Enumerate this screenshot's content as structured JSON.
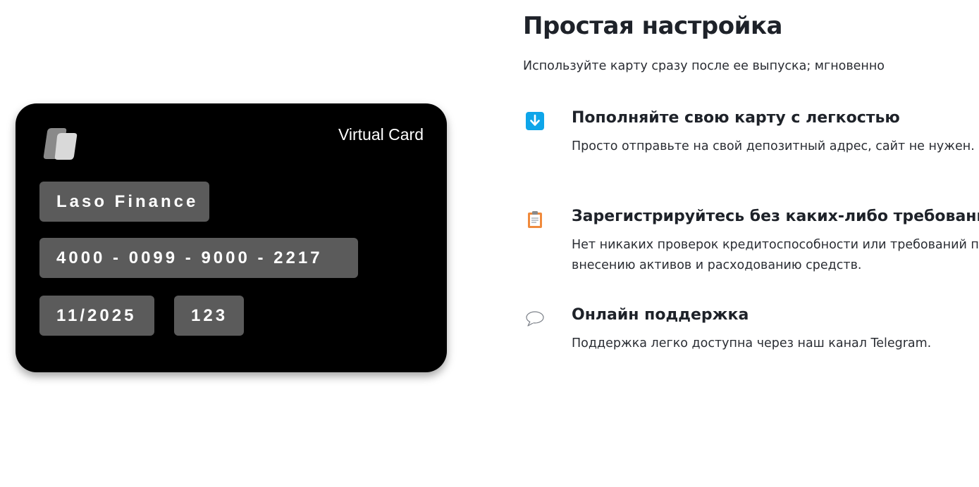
{
  "card": {
    "title": "Virtual Card",
    "holder": "Laso Finance",
    "number": "4000 - 0099 - 9000 - 2217",
    "expiry": "11/2025",
    "cvv": "123"
  },
  "section": {
    "heading": "Простая настройка",
    "subtitle": "Используйте карту сразу после ее выпуска; мгновенно"
  },
  "features": [
    {
      "icon": "down-arrow-icon",
      "title": "Пополняйте свою карту с легкостью",
      "description": "Просто отправьте на свой депозитный адрес, сайт не нужен."
    },
    {
      "icon": "clipboard-icon",
      "title": "Зарегистрируйтесь без каких-либо требований",
      "description": "Нет никаких проверок кредитоспособности или требований по внесению активов и расходованию средств."
    },
    {
      "icon": "speech-bubble-icon",
      "title": "Онлайн поддержка",
      "description": "Поддержка легко доступна через наш канал Telegram."
    }
  ],
  "colors": {
    "card_background": "#000000",
    "chip_background": "#5b5b5b",
    "arrow_icon": "#0ea5e9",
    "clipboard_icon": "#f08a3c"
  }
}
